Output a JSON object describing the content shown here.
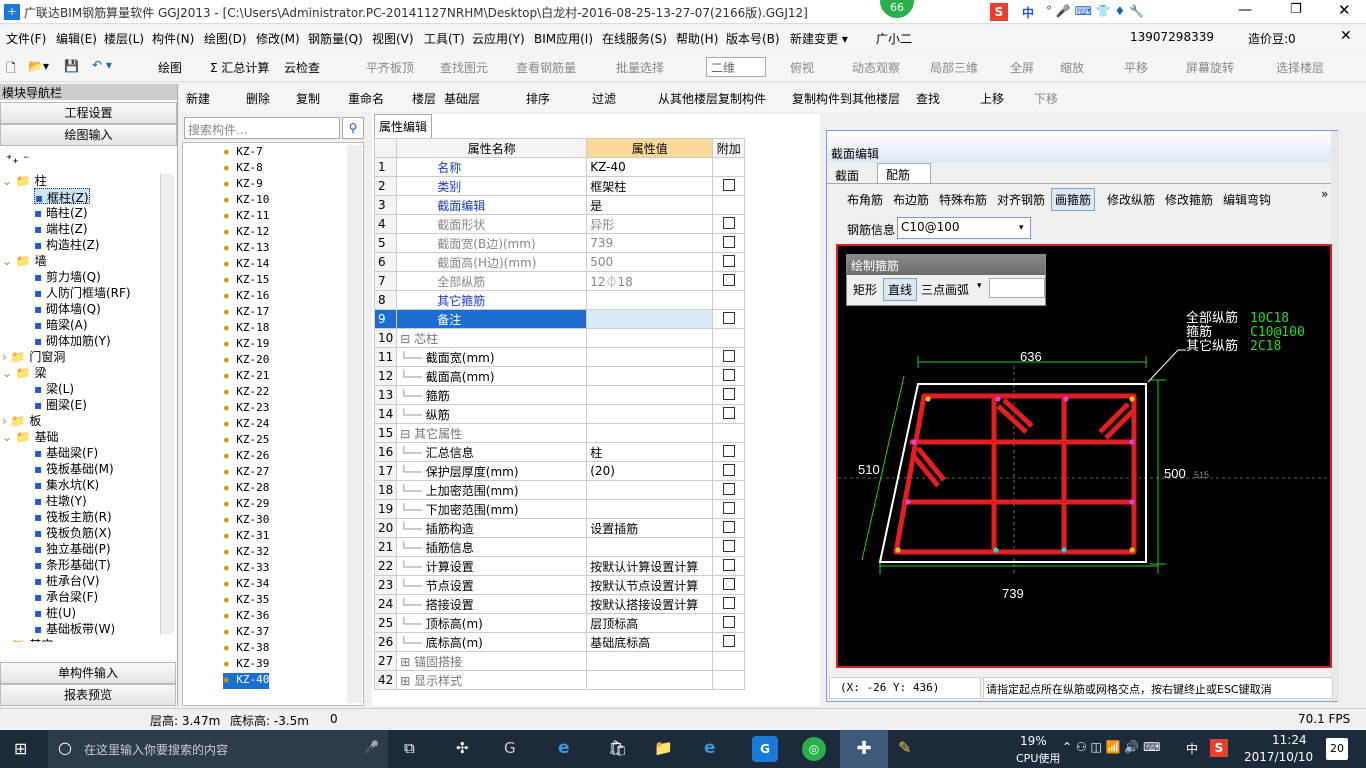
{
  "titlebar": {
    "title": "广联达BIM钢筋算量软件 GGJ2013 - [C:\\Users\\Administrator.PC-20141127NRHM\\Desktop\\白龙村-2016-08-25-13-27-07(2166版).GGJ12]",
    "badge": "66",
    "ime": "中"
  },
  "menu": [
    "文件(F)",
    "编辑(E)",
    "楼层(L)",
    "构件(N)",
    "绘图(D)",
    "修改(M)",
    "钢筋量(Q)",
    "视图(V)",
    "工具(T)",
    "云应用(Y)",
    "BIM应用(I)",
    "在线服务(S)",
    "帮助(H)",
    "版本号(B)",
    "新建变更 ▾",
    "广小二"
  ],
  "account": {
    "phone": "13907298339",
    "price": "造价豆:0"
  },
  "toolbar1": [
    "绘图",
    "Σ 汇总计算",
    "云检查",
    "平齐板顶",
    "查找图元",
    "查看钢筋量",
    "批量选择",
    "二维",
    "俯视",
    "动态观察",
    "局部三维",
    "全屏",
    "缩放",
    "平移",
    "屏幕旋转",
    "选择楼层"
  ],
  "toolbar2": [
    "新建",
    "删除",
    "复制",
    "重命名",
    "楼层",
    "基础层",
    "排序",
    "过滤",
    "从其他楼层复制构件",
    "复制构件到其他楼层",
    "查找",
    "上移",
    "下移"
  ],
  "nav": {
    "title": "模块导航栏",
    "btn_project": "工程设置",
    "btn_draw": "绘图输入",
    "btn_single": "单构件输入",
    "btn_report": "报表预览",
    "tree": [
      "柱",
      "框柱(Z)",
      "暗柱(Z)",
      "端柱(Z)",
      "构造柱(Z)",
      "墙",
      "剪力墙(Q)",
      "人防门框墙(RF)",
      "砌体墙(Q)",
      "暗梁(A)",
      "砌体加筋(Y)",
      "门窗洞",
      "梁",
      "梁(L)",
      "圈梁(E)",
      "板",
      "基础",
      "基础梁(F)",
      "筏板基础(M)",
      "集水坑(K)",
      "柱墩(Y)",
      "筏板主筋(R)",
      "筏板负筋(X)",
      "独立基础(P)",
      "条形基础(T)",
      "桩承台(V)",
      "承台梁(F)",
      "桩(U)",
      "基础板带(W)",
      "其它"
    ]
  },
  "component": {
    "search_placeholder": "搜索构件...",
    "items": [
      "KZ-7",
      "KZ-8",
      "KZ-9",
      "KZ-10",
      "KZ-11",
      "KZ-12",
      "KZ-13",
      "KZ-14",
      "KZ-15",
      "KZ-16",
      "KZ-17",
      "KZ-18",
      "KZ-19",
      "KZ-20",
      "KZ-21",
      "KZ-22",
      "KZ-23",
      "KZ-24",
      "KZ-25",
      "KZ-26",
      "KZ-27",
      "KZ-28",
      "KZ-29",
      "KZ-30",
      "KZ-31",
      "KZ-32",
      "KZ-33",
      "KZ-34",
      "KZ-35",
      "KZ-36",
      "KZ-37",
      "KZ-38",
      "KZ-39",
      "KZ-40"
    ]
  },
  "props": {
    "tab": "属性编辑",
    "h_name": "属性名称",
    "h_value": "属性值",
    "h_add": "附加",
    "rows": [
      [
        "1",
        "名称",
        "KZ-40"
      ],
      [
        "2",
        "类别",
        "框架柱"
      ],
      [
        "3",
        "截面编辑",
        "是"
      ],
      [
        "4",
        "截面形状",
        "异形"
      ],
      [
        "5",
        "截面宽(B边)(mm)",
        "739"
      ],
      [
        "6",
        "截面高(H边)(mm)",
        "500"
      ],
      [
        "7",
        "全部纵筋",
        "12⏀18"
      ],
      [
        "8",
        "其它箍筋",
        ""
      ],
      [
        "9",
        "备注",
        ""
      ],
      [
        "10",
        "芯柱",
        ""
      ],
      [
        "11",
        "截面宽(mm)",
        ""
      ],
      [
        "12",
        "截面高(mm)",
        ""
      ],
      [
        "13",
        "箍筋",
        ""
      ],
      [
        "14",
        "纵筋",
        ""
      ],
      [
        "15",
        "其它属性",
        ""
      ],
      [
        "16",
        "汇总信息",
        "柱"
      ],
      [
        "17",
        "保护层厚度(mm)",
        "(20)"
      ],
      [
        "18",
        "上加密范围(mm)",
        ""
      ],
      [
        "19",
        "下加密范围(mm)",
        ""
      ],
      [
        "20",
        "插筋构造",
        "设置插筋"
      ],
      [
        "21",
        "插筋信息",
        ""
      ],
      [
        "22",
        "计算设置",
        "按默认计算设置计算"
      ],
      [
        "23",
        "节点设置",
        "按默认节点设置计算"
      ],
      [
        "24",
        "搭接设置",
        "按默认搭接设置计算"
      ],
      [
        "25",
        "顶标高(m)",
        "层顶标高"
      ],
      [
        "26",
        "底标高(m)",
        "基础底标高"
      ],
      [
        "27",
        "锚固搭接",
        ""
      ],
      [
        "42",
        "显示样式",
        ""
      ]
    ]
  },
  "section": {
    "title": "截面编辑",
    "tab1": "截面",
    "tab2": "配筋",
    "tools": [
      "布角筋",
      "布边筋",
      "特殊布筋",
      "对齐钢筋",
      "画箍筋",
      "修改纵筋",
      "修改箍筋",
      "编辑弯钩"
    ],
    "rebar_label": "钢筋信息",
    "rebar_value": "C10@100",
    "draw_title": "绘制箍筋",
    "draw_opts": [
      "矩形",
      "直线",
      "三点画弧"
    ],
    "legend_labels": [
      "全部纵筋",
      "箍筋",
      "其它纵筋"
    ],
    "legend_values": [
      "10C18",
      "C10@100",
      "2C18"
    ],
    "dims": {
      "top": "636",
      "left": "510",
      "right": "500",
      "bottom": "739",
      "side": "515"
    },
    "coords": "(X: -26 Y: 436)",
    "hint": "请指定起点所在纵筋或网格交点，按右键终止或ESC键取消"
  },
  "status": {
    "floor_h": "层高: 3.47m",
    "base": "底标高: -3.5m",
    "zero": "0",
    "fps": "70.1 FPS"
  },
  "taskbar": {
    "search": "在这里输入你要搜索的内容",
    "cpu": "19%",
    "cpu_label": "CPU使用",
    "lang": "中",
    "time": "11:24",
    "date": "2017/10/10",
    "notif": "20"
  },
  "colors": {
    "rebar": "#e02020",
    "legend": "#22dd22",
    "accent": "#0078d7"
  }
}
